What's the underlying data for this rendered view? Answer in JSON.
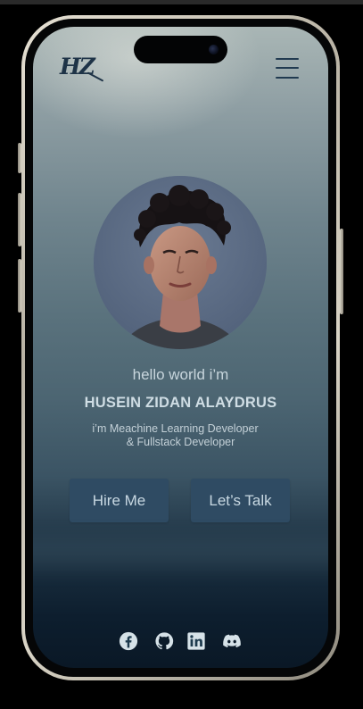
{
  "brand": {
    "logo_text": "HZ"
  },
  "hero": {
    "greeting": "hello world i’m",
    "name": "HUSEIN ZIDAN ALAYDRUS",
    "role_line_1": "i’m Meachine Learning Developer",
    "role_line_2": "& Fullstack Developer"
  },
  "actions": {
    "hire_label": "Hire Me",
    "talk_label": "Let’s Talk"
  },
  "socials": [
    {
      "icon": "facebook-icon"
    },
    {
      "icon": "github-icon"
    },
    {
      "icon": "linkedin-icon"
    },
    {
      "icon": "discord-icon"
    }
  ],
  "colors": {
    "button_bg": "#2f4b63",
    "text_light": "#c7d5dc",
    "logo": "#1e3347"
  }
}
